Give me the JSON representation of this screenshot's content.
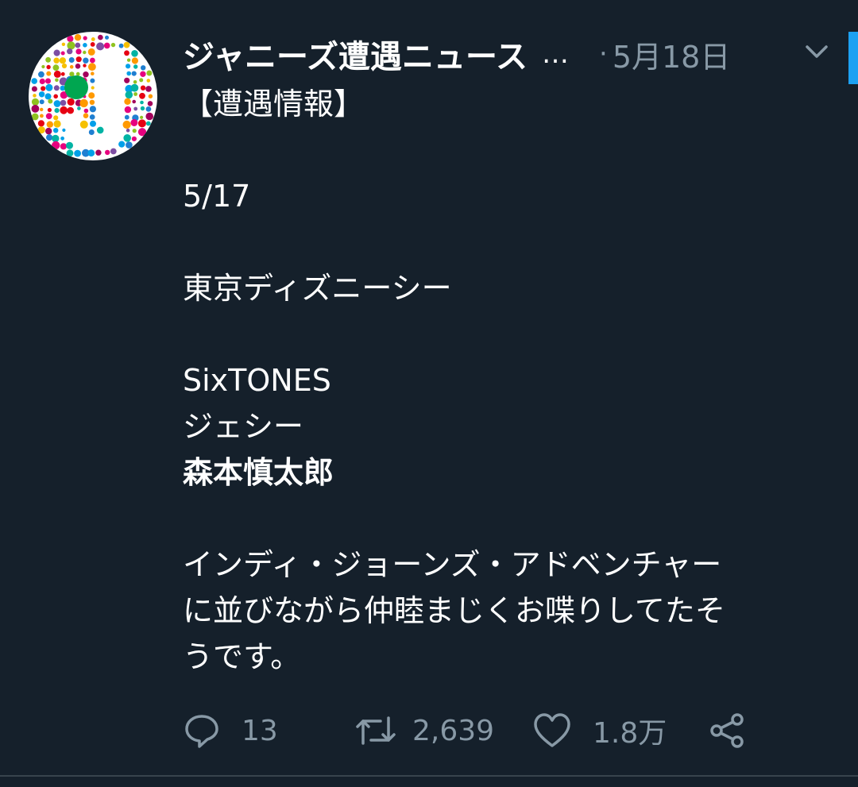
{
  "tweet": {
    "author_name": "ジャニーズ遭遇ニュース",
    "ellipsis": "…",
    "separator": "·",
    "date": "5月18日",
    "lines": [
      "【遭遇情報】",
      "",
      "5/17",
      "",
      "東京ディズニーシー",
      "",
      "SixTONES",
      "ジェシー",
      "森本慎太郎",
      "",
      "インディ・ジョーンズ・アドベンチャー",
      "に並びながら仲睦まじくお喋りしてたそ",
      "うです。"
    ]
  },
  "actions": {
    "reply_count": "13",
    "retweet_count": "2,639",
    "like_count": "1.8万"
  },
  "icons": {
    "avatar": "avatar-logo",
    "more": "chevron-down-icon",
    "reply": "reply-icon",
    "retweet": "retweet-icon",
    "like": "heart-icon",
    "share": "share-icon"
  },
  "colors": {
    "background": "#15202b",
    "secondary_text": "#8899a6",
    "accent": "#1da1f2"
  }
}
